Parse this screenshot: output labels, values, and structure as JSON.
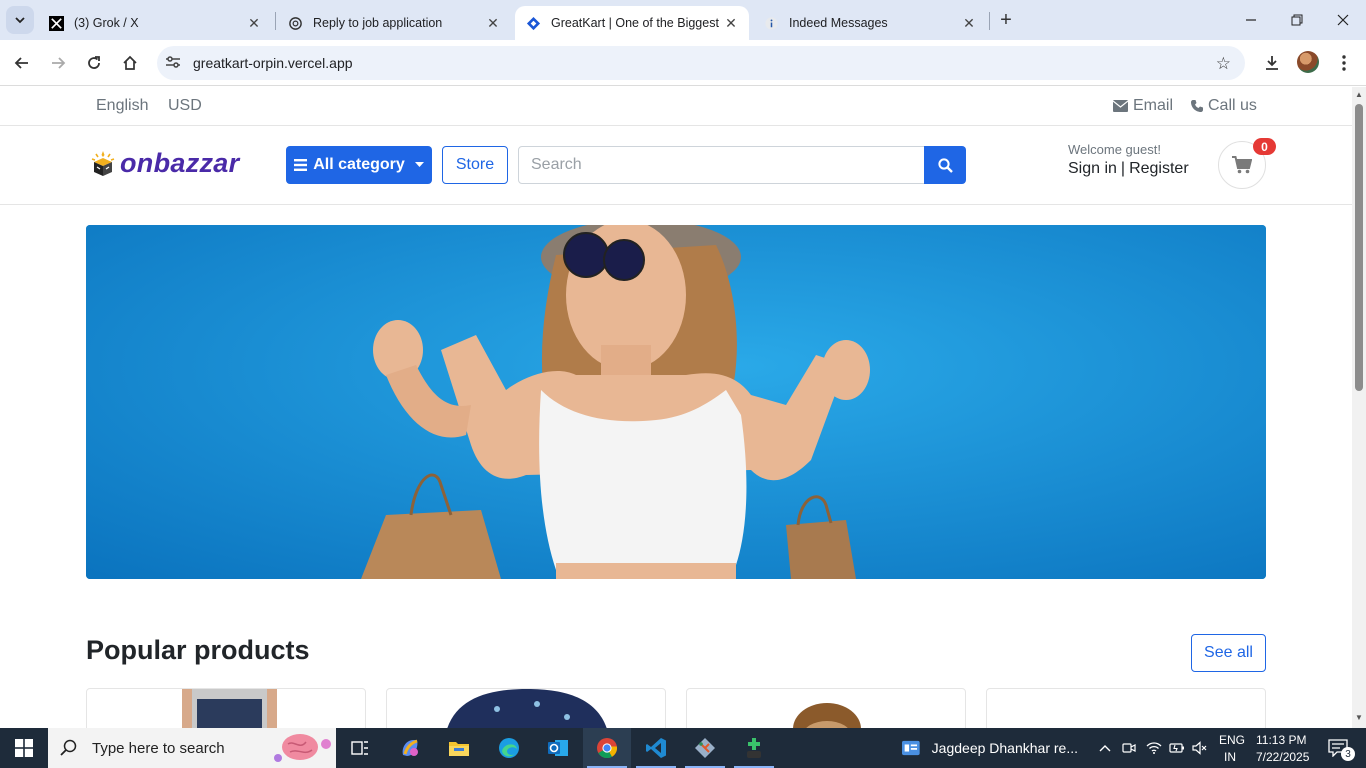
{
  "browser": {
    "tabs": [
      {
        "title": "(3) Grok / X",
        "icon": "x-logo-icon",
        "active": false
      },
      {
        "title": "Reply to job application",
        "icon": "openai-icon",
        "active": false
      },
      {
        "title": "GreatKart | One of the Biggest O",
        "icon": "site-diamond-icon",
        "active": true
      },
      {
        "title": "Indeed Messages",
        "icon": "info-icon",
        "active": false
      }
    ],
    "url": "greatkart-orpin.vercel.app"
  },
  "topbar": {
    "language": "English",
    "currency": "USD",
    "email_label": "Email",
    "call_label": "Call us"
  },
  "header": {
    "logo_text": "onbazzar",
    "category_button": "All category",
    "store_button": "Store",
    "search_placeholder": "Search",
    "welcome": "Welcome guest!",
    "sign_in": "Sign in",
    "separator": "|",
    "register": "Register",
    "cart_count": "0"
  },
  "section": {
    "title": "Popular products",
    "see_all": "See all"
  },
  "taskbar": {
    "search_placeholder": "Type here to search",
    "news": "Jagdeep Dhankhar re...",
    "lang_line1": "ENG",
    "lang_line2": "IN",
    "time": "11:13 PM",
    "date": "7/22/2025",
    "notifications": "3"
  },
  "colors": {
    "primary": "#1f66e5",
    "brand": "#4a2aa8",
    "badge": "#e53935",
    "banner_blue": "#1592d7"
  }
}
